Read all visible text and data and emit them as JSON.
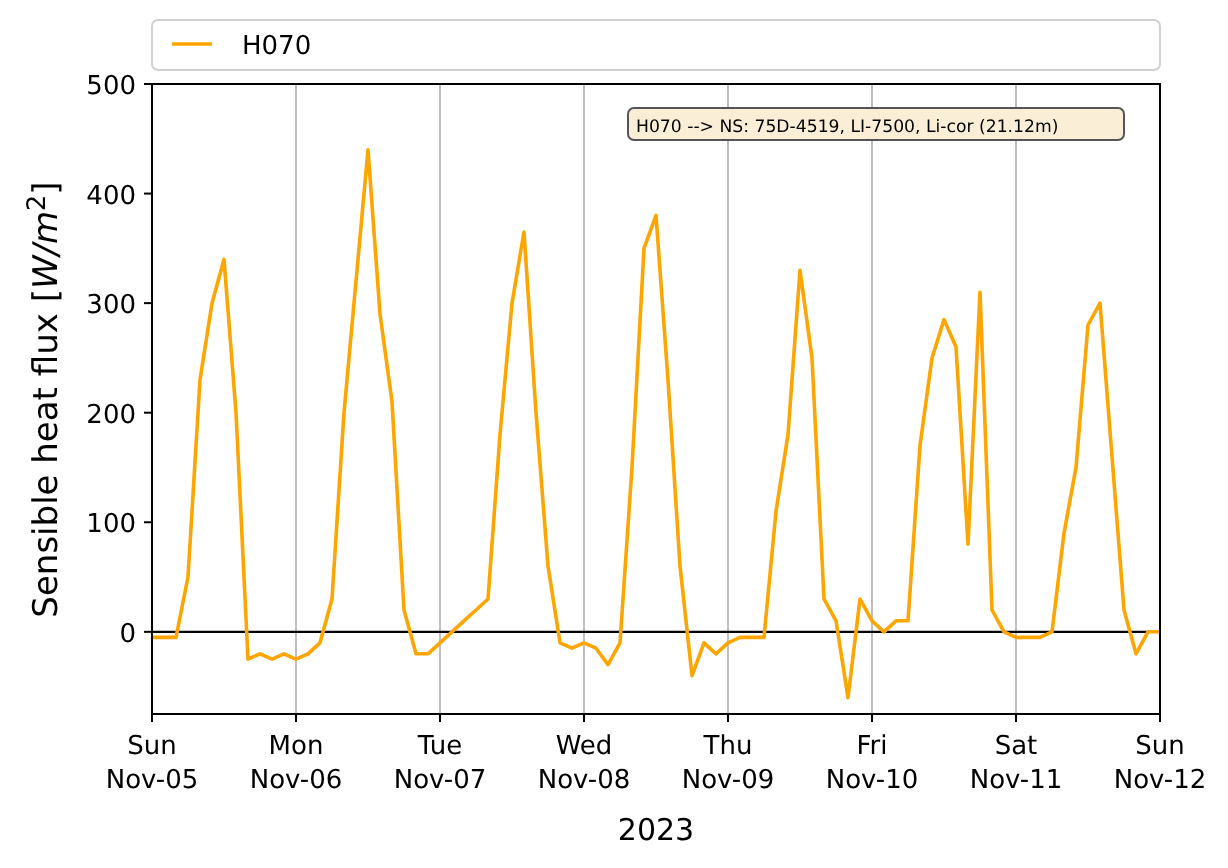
{
  "chart_data": {
    "type": "line",
    "grid": "x",
    "xlabel": "2023",
    "ylabel": "Sensible heat flux [*W/m*$^{2}$]",
    "categories": [
      "Sun\nNov-05",
      null,
      null,
      null,
      null,
      null,
      null,
      null,
      null,
      null,
      null,
      null,
      "Mon\nNov-06",
      null,
      null,
      null,
      null,
      null,
      null,
      null,
      null,
      null,
      null,
      null,
      "Tue\nNov-07",
      null,
      null,
      null,
      null,
      null,
      null,
      null,
      null,
      null,
      null,
      null,
      "Wed\nNov-08",
      null,
      null,
      null,
      null,
      null,
      null,
      null,
      null,
      null,
      null,
      null,
      "Thu\nNov-09",
      null,
      null,
      null,
      null,
      null,
      null,
      null,
      null,
      null,
      null,
      null,
      "Fri\nNov-10",
      null,
      null,
      null,
      null,
      null,
      null,
      null,
      null,
      null,
      null,
      null,
      "Sat\nNov-11",
      null,
      null,
      null,
      null,
      null,
      null,
      null,
      null,
      null,
      null,
      null,
      "Sun\nNov-12"
    ],
    "series": [
      {
        "name": "H070",
        "color": "#ffa500",
        "values": [
          -5,
          -5,
          -5,
          50,
          230,
          300,
          340,
          200,
          -25,
          -20,
          -25,
          -20,
          -25,
          -20,
          -10,
          30,
          200,
          320,
          440,
          290,
          210,
          20,
          -20,
          -20,
          -10,
          0,
          10,
          20,
          30,
          180,
          300,
          365,
          200,
          60,
          -10,
          -15,
          -10,
          -15,
          -30,
          -10,
          150,
          350,
          380,
          230,
          60,
          -40,
          -10,
          -20,
          -10,
          -5,
          -5,
          -5,
          110,
          180,
          330,
          250,
          30,
          10,
          -60,
          30,
          10,
          0,
          10,
          10,
          170,
          250,
          285,
          260,
          80,
          310,
          20,
          0,
          -5,
          -5,
          -5,
          0,
          90,
          150,
          280,
          300,
          160,
          20,
          -20,
          0,
          0
        ]
      }
    ],
    "ylim": [
      -75,
      500
    ],
    "yticks": [
      0,
      100,
      200,
      300,
      400,
      500
    ],
    "annotations": [
      {
        "text": "H070 --> NS: 75D-4519, LI-7500, Li-cor (21.12m)"
      }
    ]
  }
}
